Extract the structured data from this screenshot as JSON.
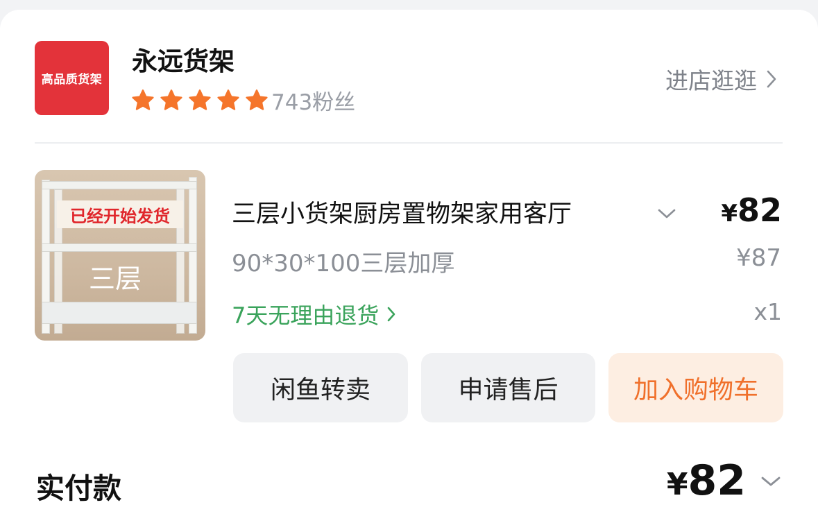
{
  "shop": {
    "logo_text": "高品质货架",
    "name": "永远货架",
    "rating_stars": 5,
    "fans": "743粉丝",
    "enter_label": "进店逛逛",
    "colors": {
      "logo_bg": "#e3333a",
      "star": "#f5752b"
    }
  },
  "product": {
    "image_banner": "已经开始发货",
    "image_label": "三层",
    "title": "三层小货架厨房置物架家用客厅",
    "price_symbol": "¥",
    "price": "82",
    "spec": "90*30*100三层加厚",
    "original_price": "¥87",
    "return_policy": "7天无理由退货",
    "quantity": "x1"
  },
  "actions": {
    "resell_label": "闲鱼转卖",
    "aftersale_label": "申请售后",
    "cart_label": "加入购物车",
    "colors": {
      "cart_text": "#f0702b",
      "cart_bg": "#fdeee2",
      "return_text": "#3aa35b"
    }
  },
  "payment": {
    "label": "实付款",
    "symbol": "¥",
    "amount": "82"
  }
}
